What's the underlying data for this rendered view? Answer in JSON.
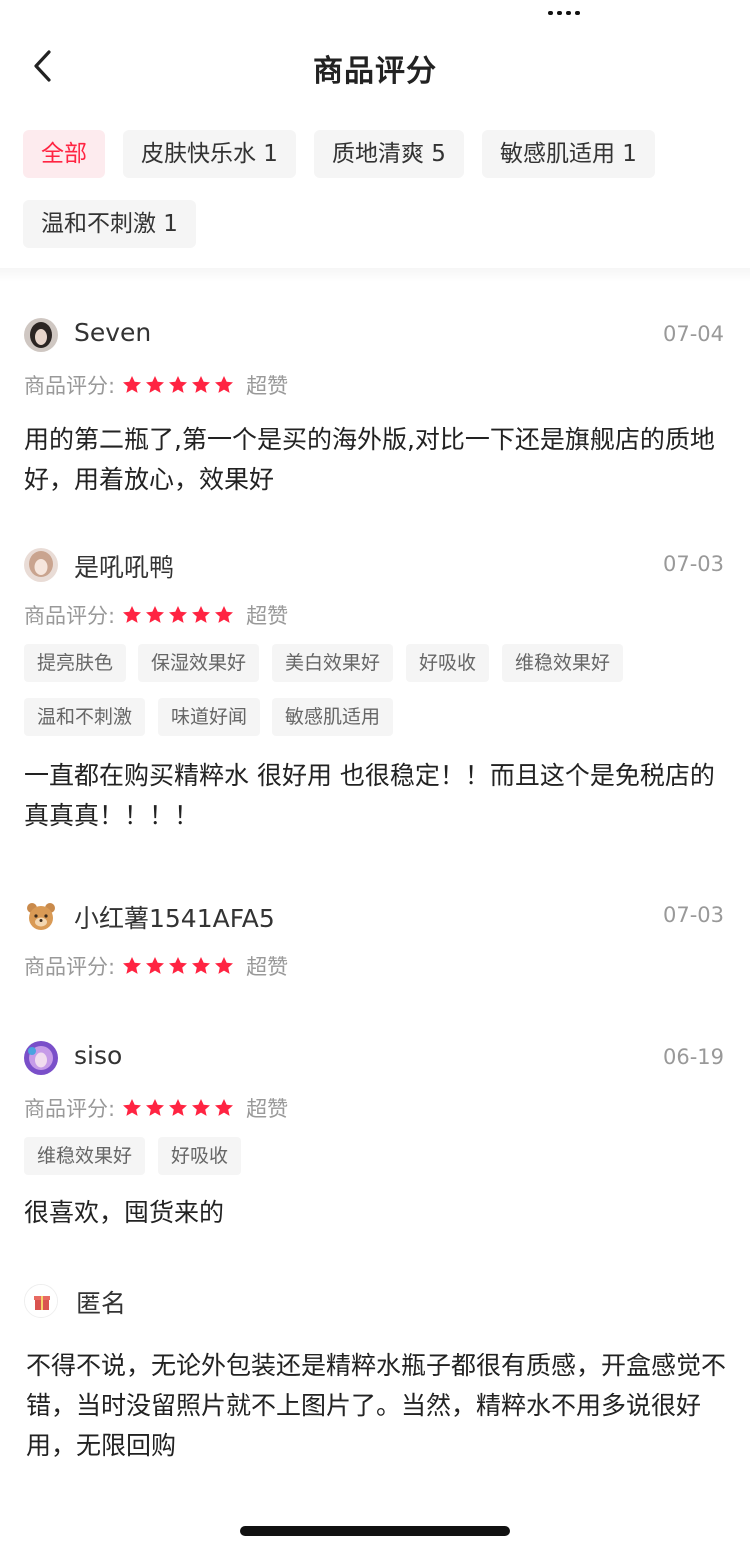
{
  "header": {
    "title": "商品评分"
  },
  "filters": [
    {
      "label": "全部",
      "active": true
    },
    {
      "label": "皮肤快乐水 1",
      "active": false
    },
    {
      "label": "质地清爽 5",
      "active": false
    },
    {
      "label": "敏感肌适用 1",
      "active": false
    },
    {
      "label": "温和不刺激 1",
      "active": false
    }
  ],
  "rating_label": "商品评分:",
  "reviews": [
    {
      "user": "Seven",
      "date": "07-04",
      "stars": 5,
      "rating_text": "超赞",
      "tags": [],
      "content": "用的第二瓶了,第一个是买的海外版,对比一下还是旗舰店的质地好，用着放心，效果好"
    },
    {
      "user": "是吼吼鸭",
      "date": "07-03",
      "stars": 5,
      "rating_text": "超赞",
      "tags": [
        "提亮肤色",
        "保湿效果好",
        "美白效果好",
        "好吸收",
        "维稳效果好",
        "温和不刺激",
        "味道好闻",
        "敏感肌适用"
      ],
      "content": "一直都在购买精粹水 很好用 也很稳定！！而且这个是免税店的  真真真！！！！"
    },
    {
      "user": "小红薯1541AFA5",
      "date": "07-03",
      "stars": 5,
      "rating_text": "超赞",
      "tags": [],
      "content": ""
    },
    {
      "user": "siso",
      "date": "06-19",
      "stars": 5,
      "rating_text": "超赞",
      "tags": [
        "维稳效果好",
        "好吸收"
      ],
      "content": "很喜欢，囤货来的"
    },
    {
      "user": "匿名",
      "content": "不得不说，无论外包装还是精粹水瓶子都很有质感，开盒感觉不错，当时没留照片就不上图片了。当然，精粹水不用多说很好用，无限回购"
    }
  ],
  "colors": {
    "accent": "#ff2442",
    "star": "#ff2442",
    "muted": "#999999",
    "chip_bg": "#f5f5f5"
  }
}
